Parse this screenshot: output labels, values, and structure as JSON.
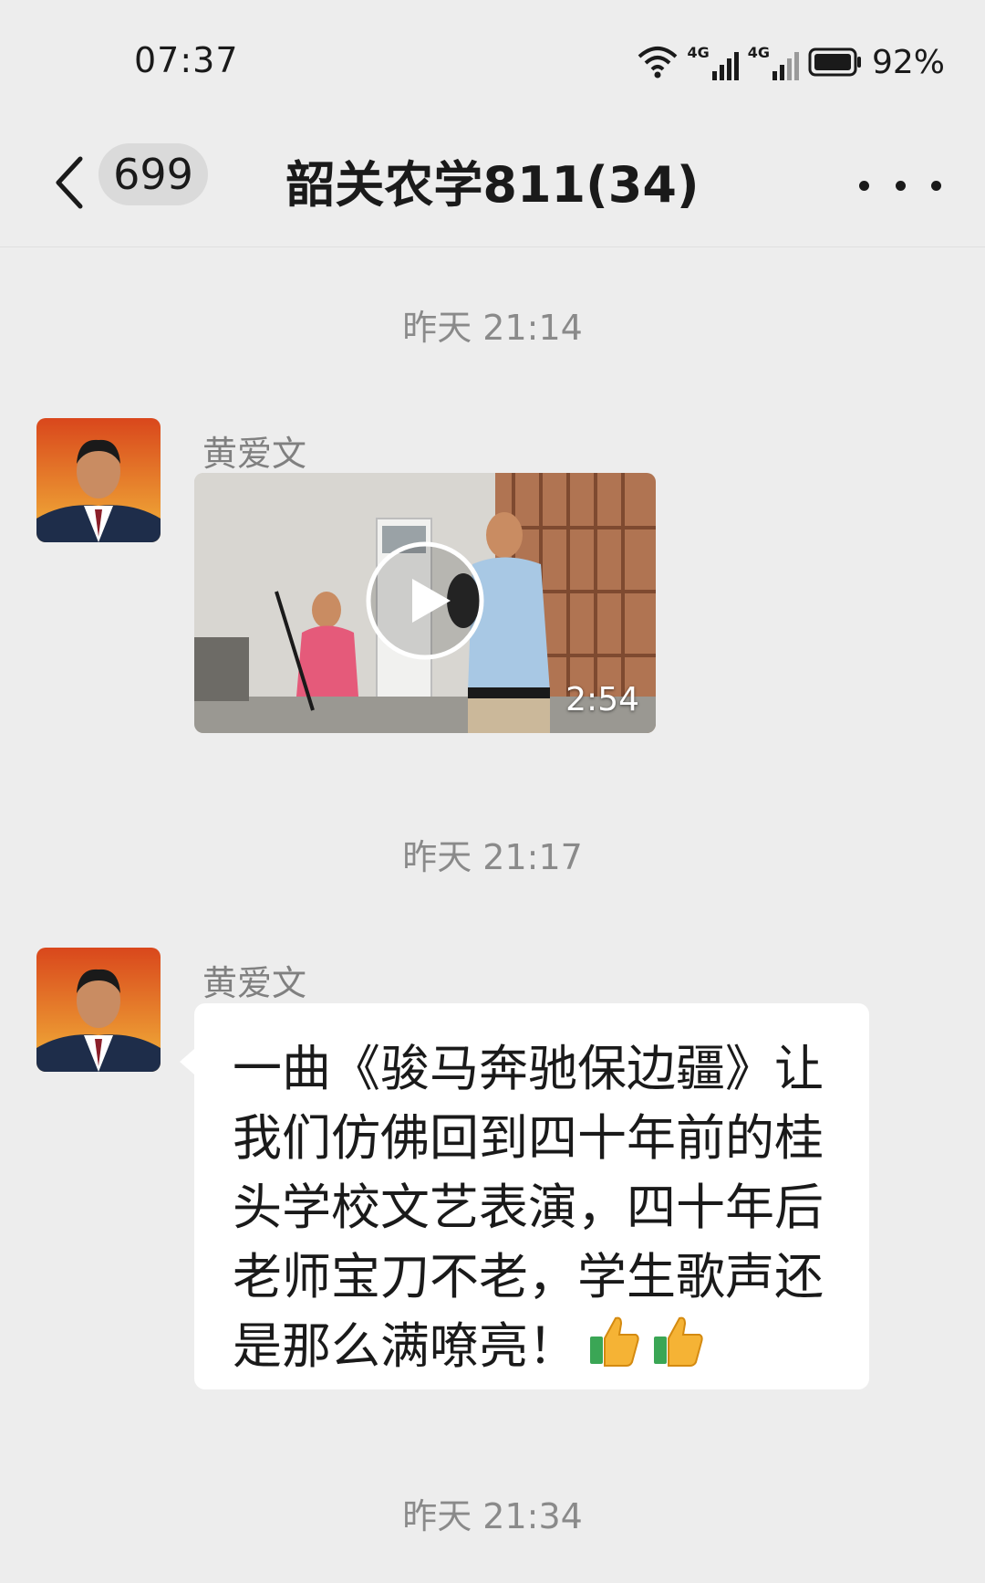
{
  "status_bar": {
    "time": "07:37",
    "battery_percent": "92%",
    "network_1": "4G",
    "network_2": "4G",
    "icons": [
      "wifi-icon",
      "signal-4g-icon",
      "signal-4g-icon",
      "battery-icon"
    ]
  },
  "header": {
    "unread_count": "699",
    "title": "韶关农学811(34)",
    "icons": [
      "back-chevron-icon",
      "more-dots-icon"
    ]
  },
  "messages": [
    {
      "timestamp": "昨天 21:14",
      "sender": "黄爱文",
      "type": "video",
      "duration": "2:54"
    },
    {
      "timestamp": "昨天 21:17",
      "sender": "黄爱文",
      "type": "text",
      "text": "一曲《骏马奔驰保边疆》让我们仿佛回到四十年前的桂头学校文艺表演，四十年后老师宝刀不老，学生歌声还是那么满嘹亮！",
      "emoji": [
        "thumbs-up-icon",
        "thumbs-up-icon"
      ]
    },
    {
      "timestamp": "昨天 21:34"
    }
  ],
  "colors": {
    "background": "#ededed",
    "bubble": "#ffffff",
    "timestamp_text": "#8a8a8a",
    "sender_text": "#808080"
  }
}
